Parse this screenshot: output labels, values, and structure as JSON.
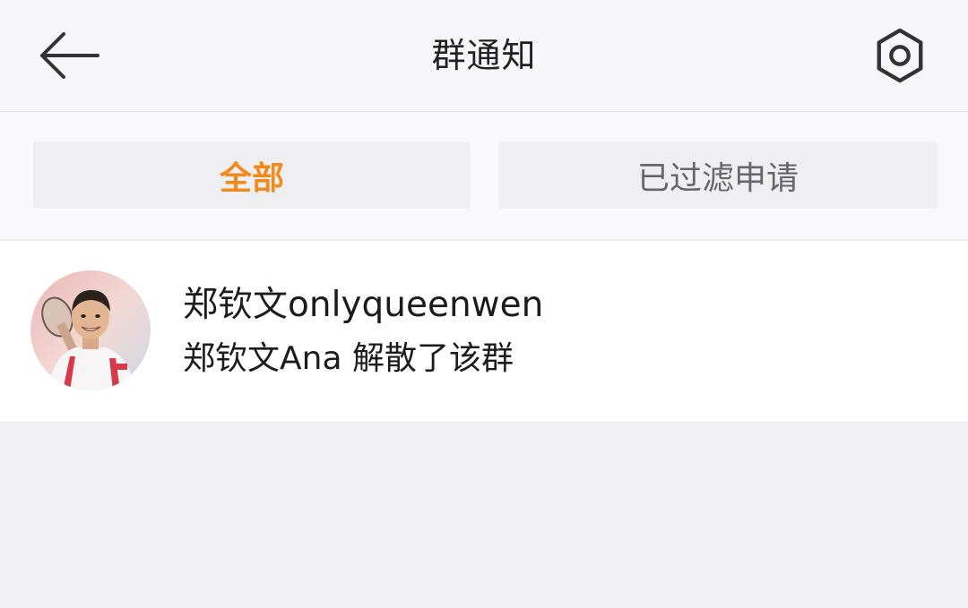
{
  "header": {
    "title": "群通知",
    "back_icon": "arrow-left-icon",
    "settings_icon": "gear-icon"
  },
  "tabs": [
    {
      "label": "全部",
      "active": true
    },
    {
      "label": "已过滤申请",
      "active": false
    }
  ],
  "notifications": [
    {
      "sender": "郑钦文onlyqueenwen",
      "message": "郑钦文Ana 解散了该群",
      "avatar": "user-avatar"
    }
  ],
  "colors": {
    "accent": "#f08a1c",
    "background": "#f1f1f3",
    "header_bg": "#f7f7f9",
    "tab_bg": "#efeff1",
    "row_bg": "#ffffff",
    "text_primary": "#1c1c1c",
    "text_secondary": "#666666"
  }
}
